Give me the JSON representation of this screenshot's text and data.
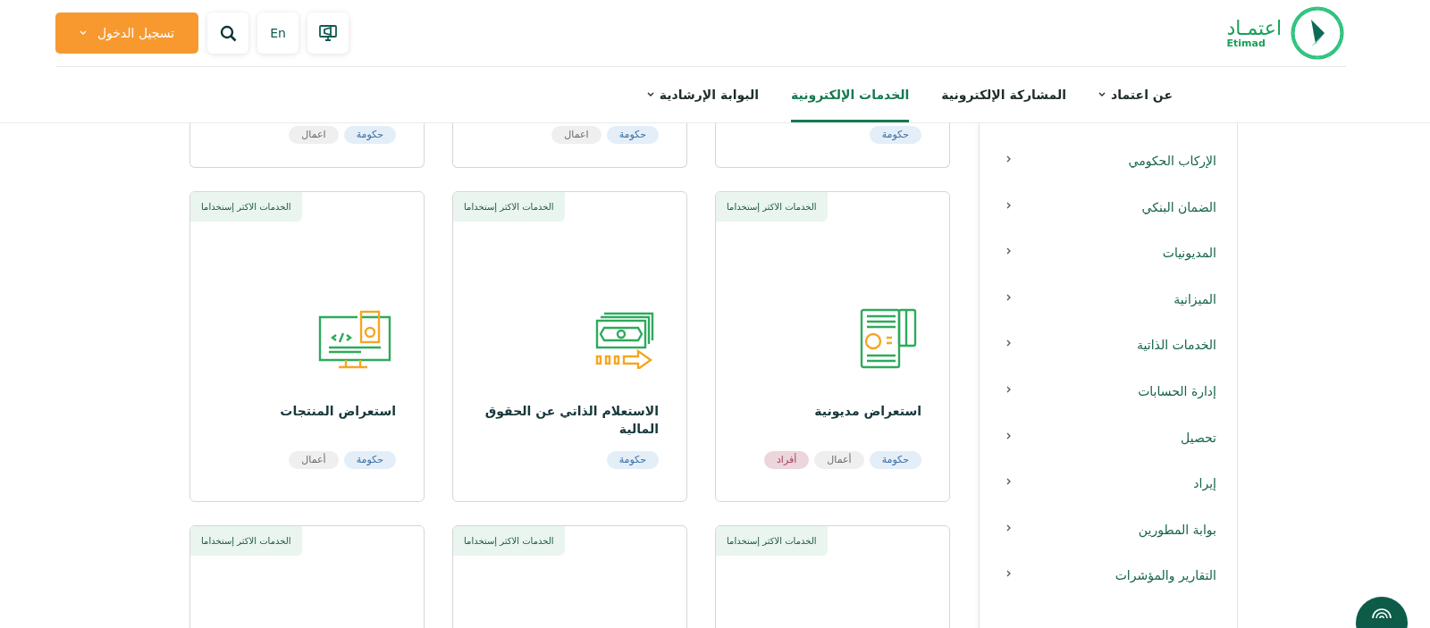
{
  "logo": {
    "text": "اعتمـاد",
    "latin": "Etimad"
  },
  "header_buttons": {
    "login": "تسجيل الدخول",
    "language": "En"
  },
  "nav": [
    {
      "label": "عن اعتماد",
      "dropdown": true,
      "selected": false
    },
    {
      "label": "المشاركة الإلكترونية",
      "dropdown": false,
      "selected": false
    },
    {
      "label": "الخدمات الإلكترونية",
      "dropdown": false,
      "selected": true
    },
    {
      "label": "البوابة الإرشادية",
      "dropdown": true,
      "selected": false
    }
  ],
  "sidebar": {
    "items": [
      "الإركاب الحكومي",
      "الضمان البنكي",
      "المديونيات",
      "الميزانية",
      "الخدمات الذاتية",
      "إدارة الحسابات",
      "تحصيل",
      "إيراد",
      "بوابة المطورين",
      "التقارير والمؤشرات"
    ]
  },
  "cards": [
    {
      "tags": [
        {
          "kind": "gov",
          "label": "حكومة"
        }
      ]
    },
    {
      "tags": [
        {
          "kind": "gov",
          "label": "حكومة"
        },
        {
          "kind": "business",
          "label": "اعمال"
        }
      ]
    },
    {
      "tags": [
        {
          "kind": "gov",
          "label": "حكومة"
        },
        {
          "kind": "business",
          "label": "اعمال"
        }
      ]
    },
    {
      "badge": "الخدمات الاكثر إستخداما",
      "kind": "document",
      "title": "استعراض مديونية",
      "tags": [
        {
          "kind": "gov",
          "label": "حكومة"
        },
        {
          "kind": "business",
          "label": "أعمال"
        },
        {
          "kind": "individuals",
          "label": "أفراد"
        }
      ]
    },
    {
      "badge": "الخدمات الاكثر إستخداما",
      "kind": "money",
      "title": "الاستعلام الذاتي عن الحقوق المالية",
      "tags": [
        {
          "kind": "gov",
          "label": "حكومة"
        }
      ]
    },
    {
      "badge": "الخدمات الاكثر إستخداما",
      "kind": "code",
      "title": "استعراض المنتجات",
      "tags": [
        {
          "kind": "gov",
          "label": "حكومة"
        },
        {
          "kind": "business",
          "label": "أعمال"
        }
      ]
    },
    {
      "badge": "الخدمات الاكثر إستخداما"
    },
    {
      "badge": "الخدمات الاكثر إستخداما"
    },
    {
      "badge": "الخدمات الاكثر إستخداما"
    }
  ]
}
